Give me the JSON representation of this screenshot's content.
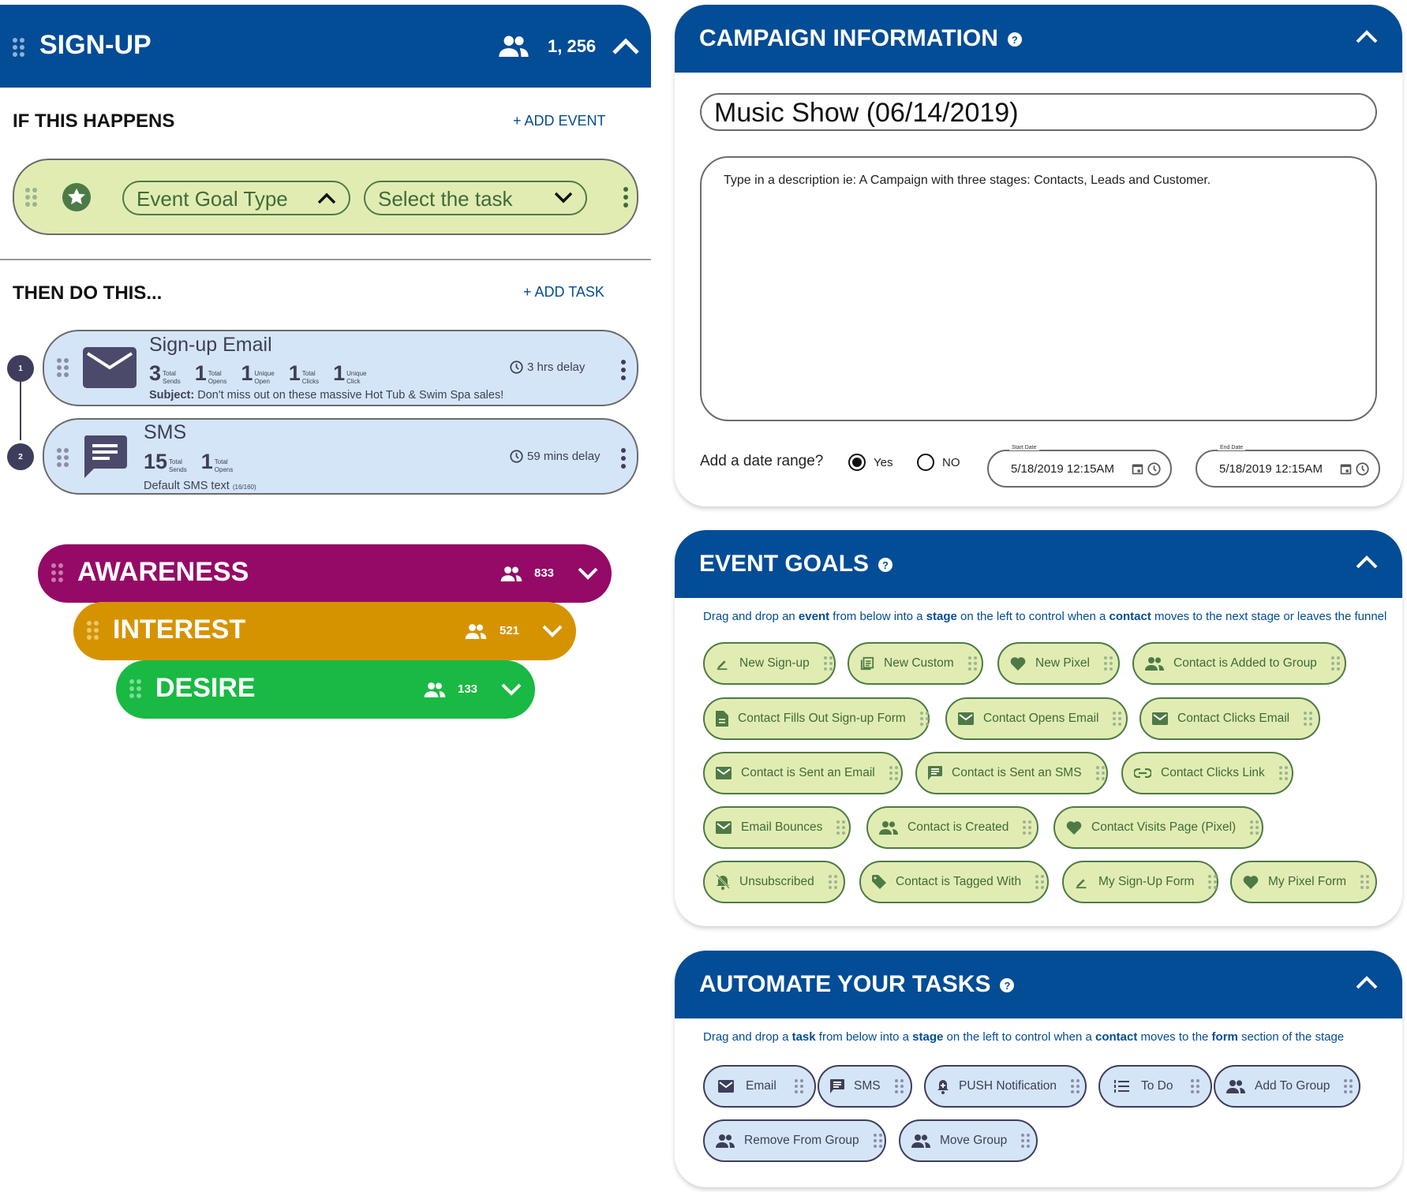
{
  "signup": {
    "title": "SIGN-UP",
    "count": "1, 256",
    "if_heading": "IF THIS HAPPENS",
    "add_event": "+ ADD EVENT",
    "event_goal_select": "Event Goal Type",
    "task_select": "Select the task",
    "then_heading": "THEN DO THIS...",
    "add_task": "+ ADD TASK",
    "tasks": [
      {
        "step": "1",
        "title": "Sign-up Email",
        "stats": [
          {
            "value": "3",
            "label1": "Total",
            "label2": "Sends"
          },
          {
            "value": "1",
            "label1": "Total",
            "label2": "Opens"
          },
          {
            "value": "1",
            "label1": "Unique",
            "label2": "Open"
          },
          {
            "value": "1",
            "label1": "Total",
            "label2": "Clicks"
          },
          {
            "value": "1",
            "label1": "Unique",
            "label2": "Click"
          }
        ],
        "subject_label": "Subject:",
        "subject": " Don't miss out on these massive Hot Tub & Swim Spa sales!",
        "delay": "3 hrs delay"
      },
      {
        "step": "2",
        "title": "SMS",
        "stats": [
          {
            "value": "15",
            "label1": "Total",
            "label2": "Sends"
          },
          {
            "value": "1",
            "label1": "Total",
            "label2": "Opens"
          }
        ],
        "body": "Default SMS text",
        "body_count": "(16/160)",
        "delay": "59 mins delay"
      }
    ]
  },
  "stages": [
    {
      "name": "AWARENESS",
      "count": "833",
      "color": "#940a66"
    },
    {
      "name": "INTEREST",
      "count": "521",
      "color": "#d69300"
    },
    {
      "name": "DESIRE",
      "count": "133",
      "color": "#19b943"
    }
  ],
  "campaign": {
    "title": "CAMPAIGN INFORMATION",
    "name_value": "Music Show (06/14/2019)",
    "description_placeholder": "Type in a description ie: A Campaign with three stages: Contacts, Leads and Customer.",
    "date_range_label": "Add a date range?",
    "yes_label": "Yes",
    "no_label": "NO",
    "date_range_selected": "Yes",
    "start_label": "Start Date",
    "start_value": "5/18/2019 12:15AM",
    "end_label": "End Date",
    "end_value": "5/18/2019 12:15AM"
  },
  "event_goals": {
    "title": "EVENT GOALS",
    "hint": [
      "Drag and drop an ",
      "event",
      " from below into a ",
      "stage",
      " on the left to control when a ",
      "contact",
      " moves to the next stage or leaves the funnel"
    ],
    "items": [
      {
        "label": "New Sign-up",
        "icon": "pencil-icon"
      },
      {
        "label": "New Custom",
        "icon": "document-list-icon"
      },
      {
        "label": "New Pixel",
        "icon": "heart-icon"
      },
      {
        "label": "Contact is Added to Group",
        "icon": "group-icon"
      },
      {
        "label": "Contact Fills Out Sign-up Form",
        "icon": "file-icon"
      },
      {
        "label": "Contact Opens Email",
        "icon": "email-icon"
      },
      {
        "label": "Contact Clicks Email",
        "icon": "email-icon"
      },
      {
        "label": "Contact is Sent an Email",
        "icon": "email-icon"
      },
      {
        "label": "Contact is Sent an SMS",
        "icon": "sms-icon"
      },
      {
        "label": "Contact Clicks Link",
        "icon": "link-icon"
      },
      {
        "label": "Email Bounces",
        "icon": "email-icon"
      },
      {
        "label": "Contact is Created",
        "icon": "group-icon"
      },
      {
        "label": "Contact Visits Page (Pixel)",
        "icon": "heart-icon"
      },
      {
        "label": "Unsubscribed",
        "icon": "bell-off-icon"
      },
      {
        "label": "Contact is Tagged With",
        "icon": "tag-icon"
      },
      {
        "label": "My Sign-Up Form",
        "icon": "pencil-icon"
      },
      {
        "label": "My Pixel Form",
        "icon": "heart-icon"
      }
    ]
  },
  "automate": {
    "title": "AUTOMATE YOUR TASKS",
    "hint": [
      "Drag and drop a ",
      "task",
      " from below into a ",
      "stage",
      " on the left to control when a ",
      "contact",
      " moves to the ",
      "form",
      " section of the stage"
    ],
    "items": [
      {
        "label": "Email",
        "icon": "email-icon"
      },
      {
        "label": "SMS",
        "icon": "sms-icon"
      },
      {
        "label": "PUSH Notification",
        "icon": "bell-plus-icon"
      },
      {
        "label": "To Do",
        "icon": "list-icon"
      },
      {
        "label": "Add To Group",
        "icon": "group-icon"
      },
      {
        "label": "Remove From Group",
        "icon": "group-icon"
      },
      {
        "label": "Move Group",
        "icon": "group-icon"
      }
    ]
  },
  "colors": {
    "brand_blue": "#034c96",
    "event_green_bg": "#e1ecb3",
    "event_green": "#3f6b38",
    "task_blue_bg": "#d4e5f7",
    "task_ink": "#3e3e5c"
  }
}
